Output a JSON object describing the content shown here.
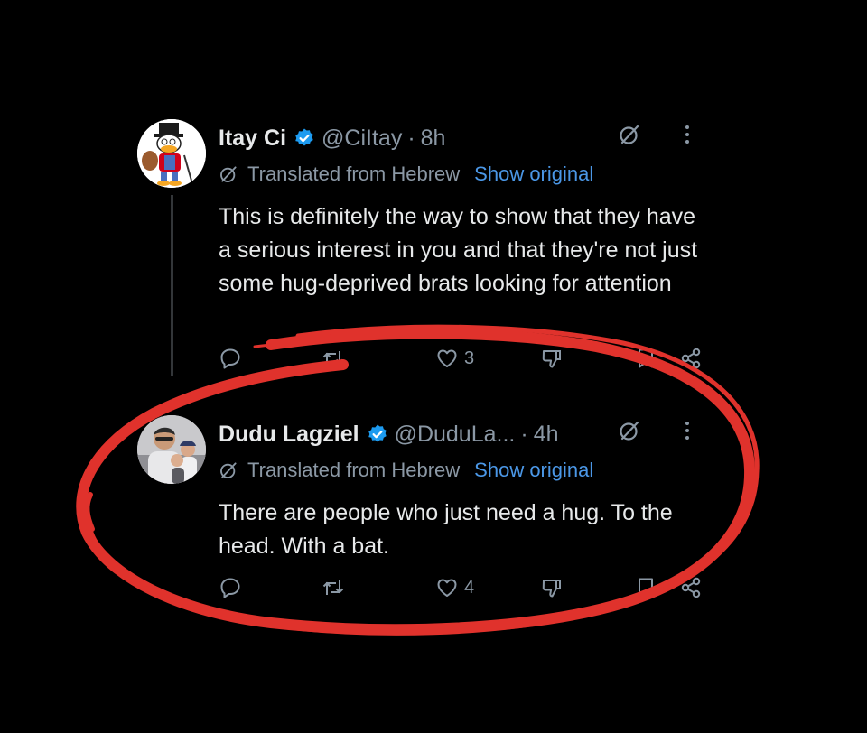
{
  "tweets": [
    {
      "name": "Itay Ci",
      "handle": "@CiItay",
      "time": "8h",
      "translated_label": "Translated from Hebrew",
      "show_original": "Show original",
      "text": "This is definitely the way to show that they have a serious interest in you and that they're not just some hug-deprived brats looking for attention",
      "likes": "3"
    },
    {
      "name": "Dudu Lagziel",
      "handle": "@DuduLa...",
      "time": "4h",
      "translated_label": "Translated from Hebrew",
      "show_original": "Show original",
      "text": "There are people who just need a hug. To the head. With a bat.",
      "likes": "4"
    }
  ],
  "icons": {
    "verified": "verified-badge-icon",
    "grok": "grok-icon",
    "more": "more-icon",
    "translate": "translate-icon",
    "reply": "reply-icon",
    "repost": "repost-icon",
    "like": "heart-icon",
    "dislike": "dislike-icon",
    "bookmark": "bookmark-icon",
    "share": "share-icon"
  },
  "colors": {
    "background": "#000000",
    "text": "#e7e9ea",
    "muted": "#8b98a5",
    "link": "#4b97e6",
    "verified": "#1d9bf0",
    "annotation": "#e0322c"
  }
}
